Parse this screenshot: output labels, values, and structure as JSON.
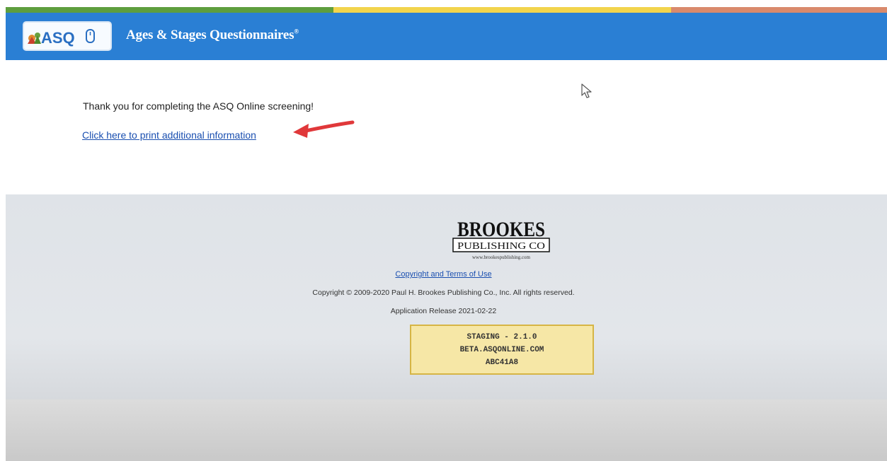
{
  "header": {
    "logo_text": "ASQ",
    "title": "Ages & Stages Questionnaires",
    "title_mark": "®"
  },
  "main": {
    "thank_you": "Thank you for completing the ASQ Online screening!",
    "print_link": "Click here to print additional information"
  },
  "footer": {
    "publisher_logo": {
      "name": "BROOKES",
      "subtitle": "PUBLISHING CO",
      "url": "www.brookespublishing.com"
    },
    "terms_link": "Copyright and Terms of Use",
    "copyright": "Copyright © 2009-2020 Paul H. Brookes Publishing Co., Inc. All rights reserved.",
    "release": "Application Release 2021-02-22",
    "staging": [
      "STAGING - 2.1.0",
      "BETA.ASQONLINE.COM",
      "ABC41A8"
    ]
  },
  "colors": {
    "header_bg": "#2a7fd4",
    "link": "#1a4fb0",
    "stripe_green": "#5e9e3e",
    "stripe_yellow": "#f2d44c",
    "stripe_salmon": "#d98a6c",
    "staging_bg": "#f6e7a6",
    "annotation_arrow": "#e0383a"
  }
}
